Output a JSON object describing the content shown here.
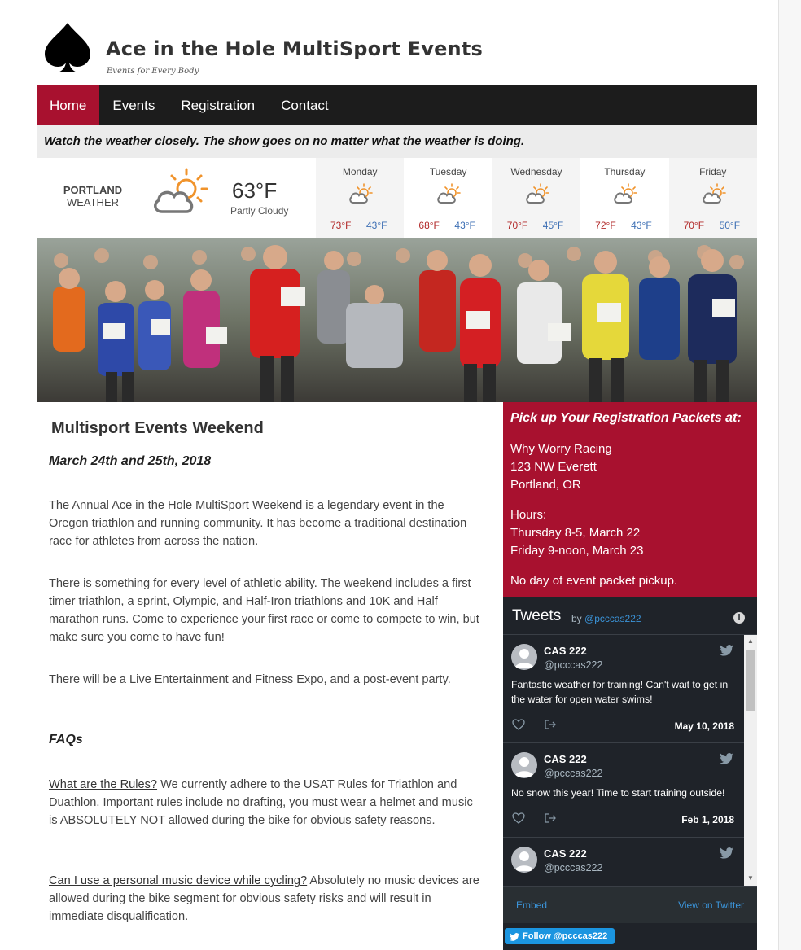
{
  "site": {
    "title": "Ace in the Hole MultiSport Events",
    "tagline": "Events for Every Body"
  },
  "nav": {
    "items": [
      {
        "label": "Home",
        "active": true
      },
      {
        "label": "Events"
      },
      {
        "label": "Registration"
      },
      {
        "label": "Contact"
      }
    ]
  },
  "notice": "Watch the weather closely. The show goes on no matter what the weather is doing.",
  "weather": {
    "city": "PORTLAND",
    "label": "WEATHER",
    "current_temp": "63°F",
    "condition": "Partly Cloudy",
    "icon": "partly-cloudy-icon",
    "forecast": [
      {
        "day": "Monday",
        "high": "73°F",
        "low": "43°F",
        "icon": "partly-cloudy-icon"
      },
      {
        "day": "Tuesday",
        "high": "68°F",
        "low": "43°F",
        "icon": "partly-cloudy-icon"
      },
      {
        "day": "Wednesday",
        "high": "70°F",
        "low": "45°F",
        "icon": "partly-cloudy-icon"
      },
      {
        "day": "Thursday",
        "high": "72°F",
        "low": "43°F",
        "icon": "partly-cloudy-icon"
      },
      {
        "day": "Friday",
        "high": "70°F",
        "low": "50°F",
        "icon": "partly-cloudy-icon"
      }
    ],
    "colors": {
      "high": "#b22a2a",
      "low": "#3d6fb4",
      "sun": "#f0932b",
      "cloud": "#777777"
    }
  },
  "main": {
    "title": "Multisport Events Weekend",
    "date": "March 24th and 25th, 2018",
    "p1": "The Annual Ace in the Hole MultiSport Weekend is a legendary event in the Oregon triathlon and running community. It has become a traditional destination race for athletes from across the nation.",
    "p2": "There is something for every level of athletic ability. The weekend includes a first timer triathlon, a sprint, Olympic, and Half-Iron triathlons and 10K and Half marathon runs. Come to experience your first race or come to compete to win, but make sure you come to have fun!",
    "p3": "There will be a Live Entertainment and Fitness Expo, and a post-event party.",
    "faq_heading": "FAQs",
    "faqs": [
      {
        "question": "What are the Rules?",
        "answer": " We currently adhere to the USAT Rules for Triathlon and Duathlon. Important rules include no drafting, you must wear a helmet and music is ABSOLUTELY NOT allowed during the bike for obvious safety reasons."
      },
      {
        "question": "Can I use a personal music device while cycling?",
        "answer": " Absolutely no music devices are allowed during the bike segment for obvious safety risks and will result in immediate disqualification."
      }
    ]
  },
  "pickup": {
    "heading": "Pick up Your Registration Packets at:",
    "store": "Why Worry Racing",
    "street": "123 NW Everett",
    "city": "Portland, OR",
    "hours_label": "Hours:",
    "hours_1": "Thursday 8-5, March 22",
    "hours_2": "Friday 9-noon, March 23",
    "note": "No day of event packet pickup.",
    "color": "#a8112f"
  },
  "twitter": {
    "title": "Tweets",
    "by": "by",
    "handle": "@pcccas222",
    "tweets": [
      {
        "name": "CAS 222",
        "handle": "@pcccas222",
        "text": "Fantastic weather for training! Can't wait to get in the water for open water swims!",
        "date": "May 10, 2018"
      },
      {
        "name": "CAS 222",
        "handle": "@pcccas222",
        "text": "No snow this year! Time to start training outside!",
        "date": "Feb 1, 2018"
      },
      {
        "name": "CAS 222",
        "handle": "@pcccas222",
        "text": "",
        "date": ""
      }
    ],
    "embed_label": "Embed",
    "view_label": "View on Twitter",
    "follow_label": "Follow @pcccas222",
    "accent": "#1b95e0"
  }
}
